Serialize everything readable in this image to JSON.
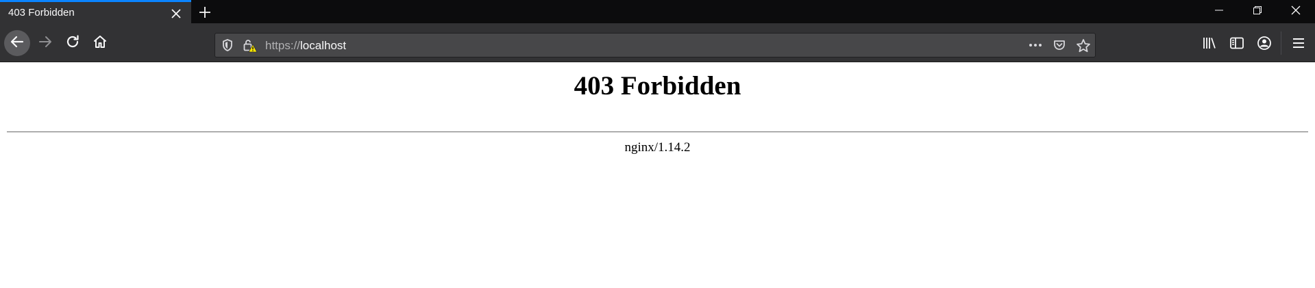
{
  "tab": {
    "title": "403 Forbidden"
  },
  "address_bar": {
    "protocol": "https://",
    "host": "localhost"
  },
  "page": {
    "heading": "403 Forbidden",
    "server_signature": "nginx/1.14.2"
  },
  "icons": {
    "tab_close": "close-icon",
    "new_tab": "plus-icon",
    "back": "arrow-left-icon",
    "forward": "arrow-right-icon",
    "reload": "reload-icon",
    "home": "home-icon",
    "tracking": "shield-icon",
    "insecure": "lock-warning-icon",
    "page_actions": "ellipsis-icon",
    "pocket": "pocket-icon",
    "bookmark": "star-icon",
    "library": "library-icon",
    "sidebars": "sidebar-icon",
    "account": "account-icon",
    "menu": "hamburger-icon",
    "minimize": "minimize-icon",
    "restore": "restore-icon",
    "close_window": "close-icon"
  },
  "colors": {
    "titlebar": "#0c0c0d",
    "active_tab": "#323234",
    "tab_highlight": "#0a84ff",
    "toolbar": "#323234",
    "urlbar": "#474749",
    "warning": "#ffe900"
  }
}
